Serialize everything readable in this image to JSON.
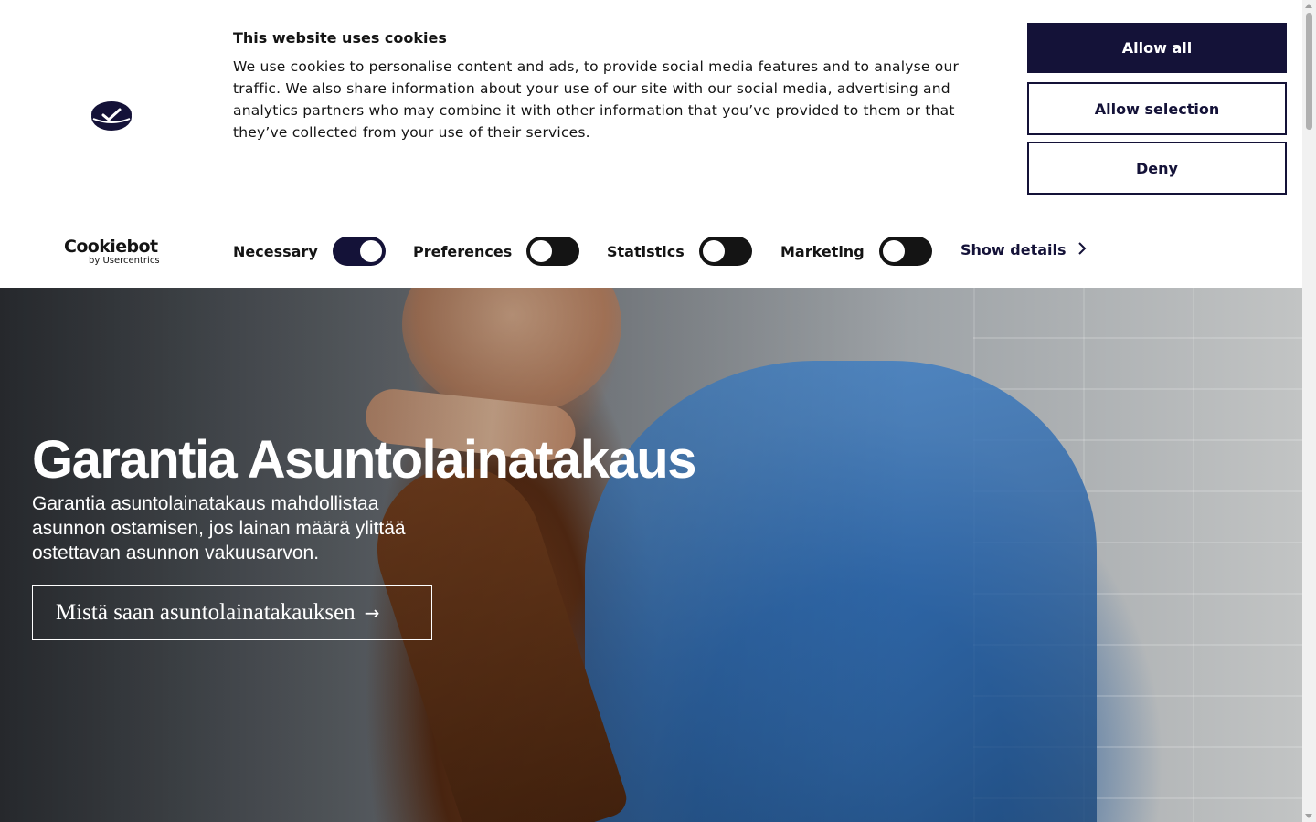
{
  "cookie_banner": {
    "title": "This website uses cookies",
    "description": "We use cookies to personalise content and ads, to provide social media features and to analyse our traffic. We also share information about your use of our site with our social media, advertising and analytics partners who may combine it with other information that you’ve provided to them or that they’ve collected from your use of their services.",
    "buttons": {
      "allow_all": "Allow all",
      "allow_selection": "Allow selection",
      "deny": "Deny"
    },
    "toggles": [
      {
        "label": "Necessary",
        "on": true
      },
      {
        "label": "Preferences",
        "on": false
      },
      {
        "label": "Statistics",
        "on": false
      },
      {
        "label": "Marketing",
        "on": false
      }
    ],
    "show_details": "Show details",
    "provider_logo": {
      "name": "Cookiebot",
      "byline": "by Usercentrics"
    },
    "colors": {
      "primary": "#141238",
      "text": "#141414"
    }
  },
  "hero": {
    "title": "Garantia Asuntolainatakaus",
    "subtitle": "Garantia asuntolainatakaus mahdollistaa asunnon ostamisen, jos lainan määrä ylittää ostettavan asunnon vakuusarvon.",
    "cta_label": "Mistä saan asuntolainatakauksen",
    "cta_arrow": "→"
  },
  "icons": {
    "brand_logo": "garantia-logo-icon",
    "chevron": "chevron-right-icon"
  }
}
